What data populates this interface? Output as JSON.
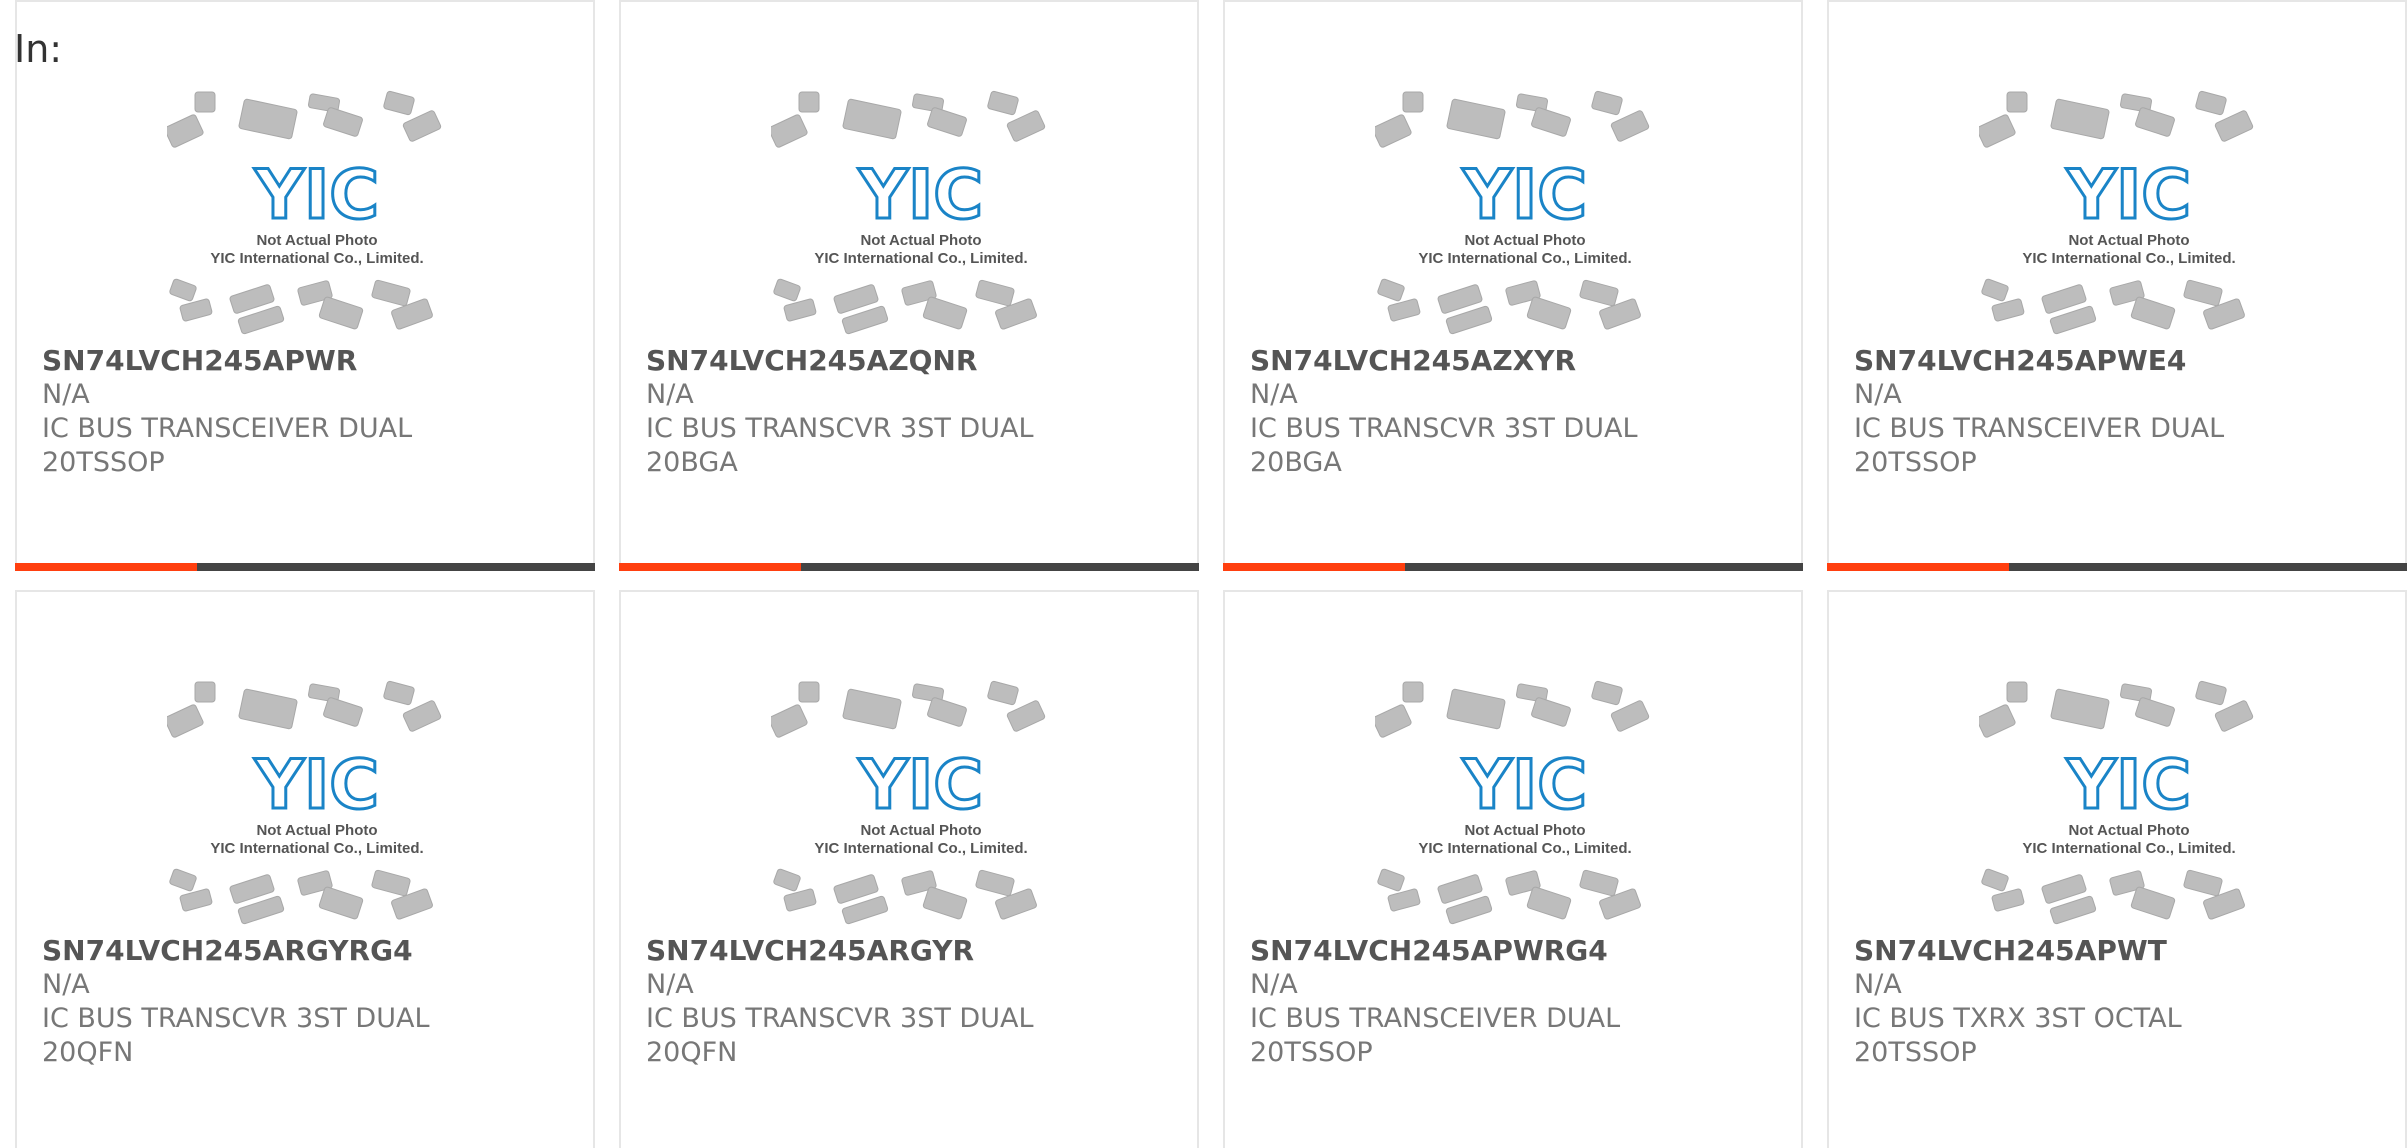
{
  "header": {
    "in_label": "In:"
  },
  "placeholder": {
    "logo_text": "YIC",
    "line1": "Not Actual Photo",
    "line2": "YIC International Co., Limited."
  },
  "colors": {
    "accent": "#ff3f0f",
    "bar": "#444444",
    "logo_blue": "#1a84c7",
    "chip_gray": "#bdbdbd"
  },
  "products": [
    {
      "part_number": "SN74LVCH245APWR",
      "manufacturer": "N/A",
      "description": "IC BUS TRANSCEIVER DUAL 20TSSOP"
    },
    {
      "part_number": "SN74LVCH245AZQNR",
      "manufacturer": "N/A",
      "description": "IC BUS TRANSCVR 3ST DUAL 20BGA"
    },
    {
      "part_number": "SN74LVCH245AZXYR",
      "manufacturer": "N/A",
      "description": "IC BUS TRANSCVR 3ST DUAL 20BGA"
    },
    {
      "part_number": "SN74LVCH245APWE4",
      "manufacturer": "N/A",
      "description": "IC BUS TRANSCEIVER DUAL 20TSSOP"
    },
    {
      "part_number": "SN74LVCH245ARGYRG4",
      "manufacturer": "N/A",
      "description": "IC BUS TRANSCVR 3ST DUAL 20QFN"
    },
    {
      "part_number": "SN74LVCH245ARGYR",
      "manufacturer": "N/A",
      "description": "IC BUS TRANSCVR 3ST DUAL 20QFN"
    },
    {
      "part_number": "SN74LVCH245APWRG4",
      "manufacturer": "N/A",
      "description": "IC BUS TRANSCEIVER DUAL 20TSSOP"
    },
    {
      "part_number": "SN74LVCH245APWT",
      "manufacturer": "N/A",
      "description": "IC BUS TXRX 3ST OCTAL 20TSSOP"
    }
  ]
}
